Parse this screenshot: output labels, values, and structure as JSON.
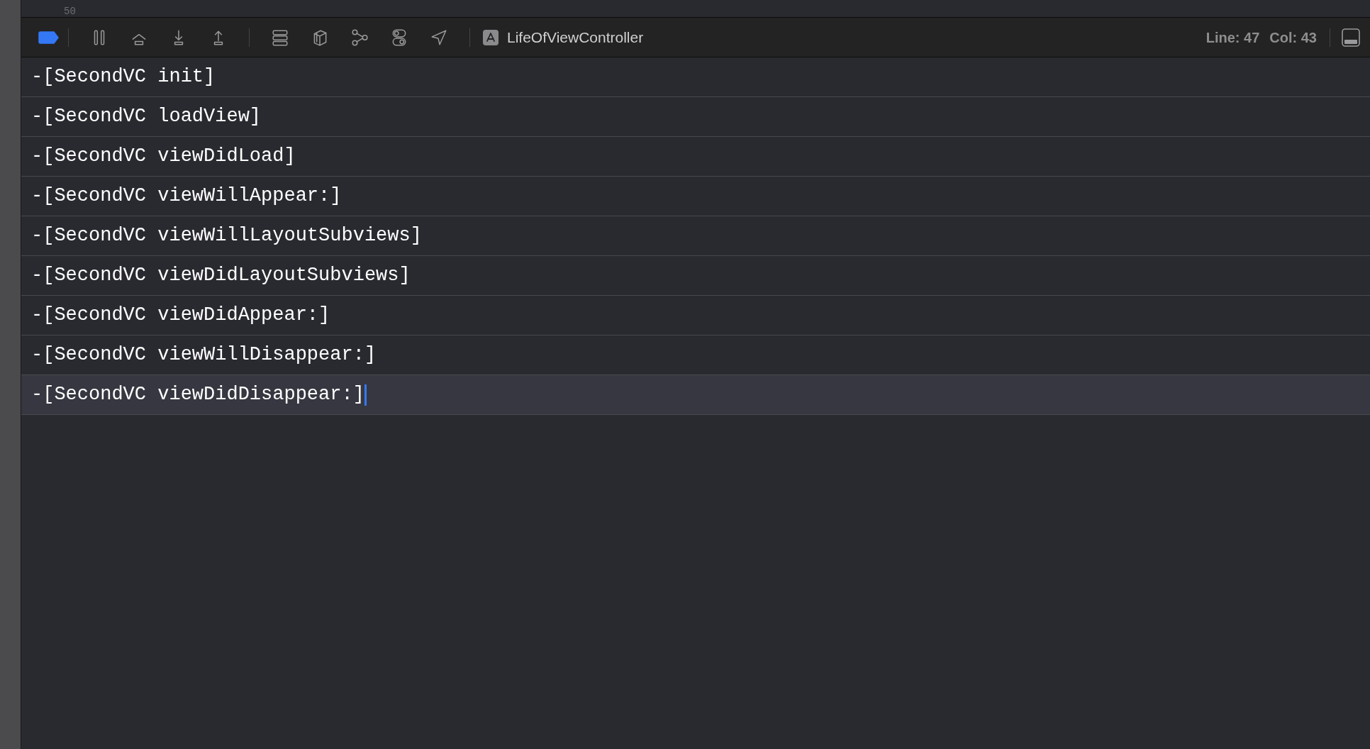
{
  "editor": {
    "line_number": "50"
  },
  "debug_bar": {
    "breakpoints_active": true,
    "process": "LifeOfViewController",
    "line": "Line: 47",
    "col": "Col: 43"
  },
  "console": {
    "lines": [
      {
        "text": "-[SecondVC init]",
        "selected": false
      },
      {
        "text": "-[SecondVC loadView]",
        "selected": false
      },
      {
        "text": "-[SecondVC viewDidLoad]",
        "selected": false
      },
      {
        "text": "-[SecondVC viewWillAppear:]",
        "selected": false
      },
      {
        "text": "-[SecondVC viewWillLayoutSubviews]",
        "selected": false
      },
      {
        "text": "-[SecondVC viewDidLayoutSubviews]",
        "selected": false
      },
      {
        "text": "-[SecondVC viewDidAppear:]",
        "selected": false
      },
      {
        "text": "-[SecondVC viewWillDisappear:]",
        "selected": false
      },
      {
        "text": "-[SecondVC viewDidDisappear:]",
        "selected": true
      }
    ]
  }
}
